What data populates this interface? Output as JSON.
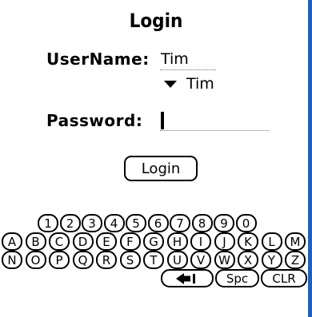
{
  "title": "Login",
  "username": {
    "label": "UserName:",
    "value": "Tim",
    "dropdown_value": "Tim"
  },
  "password": {
    "label": "Password:",
    "value": ""
  },
  "login_button": "Login",
  "keyboard": {
    "row_numbers": [
      "1",
      "2",
      "3",
      "4",
      "5",
      "6",
      "7",
      "8",
      "9",
      "0"
    ],
    "row_a_m": [
      "A",
      "B",
      "C",
      "D",
      "E",
      "F",
      "G",
      "H",
      "I",
      "J",
      "K",
      "L",
      "M"
    ],
    "row_n_z": [
      "N",
      "O",
      "P",
      "Q",
      "R",
      "S",
      "T",
      "U",
      "V",
      "W",
      "X",
      "Y",
      "Z"
    ],
    "backspace_icon": "backspace-arrow-icon",
    "space_label": "Spc",
    "clear_label": "CLR"
  },
  "colors": {
    "right_edge": "#1f5fbf"
  }
}
